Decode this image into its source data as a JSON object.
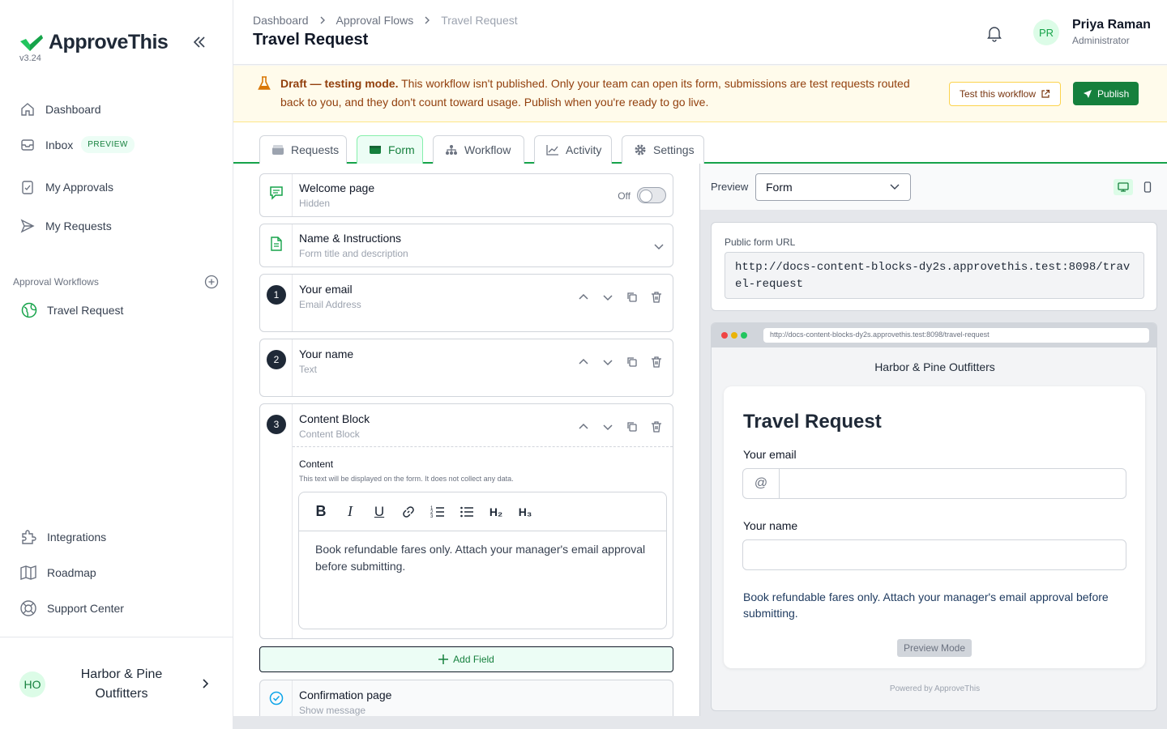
{
  "app": {
    "name": "ApproveThis",
    "version": "v3.24"
  },
  "sidebar": {
    "nav": [
      {
        "label": "Dashboard",
        "icon": "home-icon"
      },
      {
        "label": "Inbox",
        "icon": "inbox-icon",
        "badge": "PREVIEW"
      },
      {
        "label": "My Approvals",
        "icon": "clipboard-check-icon"
      },
      {
        "label": "My Requests",
        "icon": "send-icon"
      }
    ],
    "section_label": "Approval Workflows",
    "workflows": [
      {
        "label": "Travel Request",
        "icon": "globe-icon"
      }
    ],
    "footer_nav": [
      {
        "label": "Integrations",
        "icon": "puzzle-icon"
      },
      {
        "label": "Roadmap",
        "icon": "map-icon"
      },
      {
        "label": "Support Center",
        "icon": "lifebuoy-icon"
      }
    ],
    "org": {
      "initials": "HO",
      "name": "Harbor & Pine Outfitters"
    }
  },
  "header": {
    "breadcrumbs": [
      "Dashboard",
      "Approval Flows",
      "Travel Request"
    ],
    "title": "Travel Request",
    "user": {
      "initials": "PR",
      "name": "Priya Raman",
      "role": "Administrator"
    }
  },
  "banner": {
    "strong": "Draft — testing mode.",
    "text": " This workflow isn't published. Only your team can open its form, submissions are test requests routed back to you, and they don't count toward usage. Publish when you're ready to go live.",
    "test_button": "Test this workflow",
    "publish_button": "Publish",
    "accent": "#92400e"
  },
  "tabs": [
    {
      "label": "Requests",
      "active": false
    },
    {
      "label": "Form",
      "active": true
    },
    {
      "label": "Workflow",
      "active": false
    },
    {
      "label": "Activity",
      "active": false
    },
    {
      "label": "Settings",
      "active": false
    }
  ],
  "form_editor": {
    "welcome": {
      "title": "Welcome page",
      "subtitle": "Hidden",
      "toggle_label": "Off"
    },
    "name_instructions": {
      "title": "Name & Instructions",
      "subtitle": "Form title and description"
    },
    "fields": [
      {
        "number": "1",
        "title": "Your email",
        "type": "Email Address"
      },
      {
        "number": "2",
        "title": "Your name",
        "type": "Text"
      },
      {
        "number": "3",
        "title": "Content Block",
        "type": "Content Block"
      }
    ],
    "content_block": {
      "label": "Content",
      "help": "This text will be displayed on the form. It does not collect any data.",
      "toolbar": [
        "B",
        "I",
        "U",
        "link",
        "ordered-list",
        "bullet-list",
        "H₂",
        "H₃"
      ],
      "text": "Book refundable fares only. Attach your manager's email approval before submitting."
    },
    "add_field": "Add Field",
    "confirmation": {
      "title": "Confirmation page",
      "subtitle": "Show message"
    }
  },
  "preview": {
    "label": "Preview",
    "mode": "Form",
    "url_label": "Public form URL",
    "url": "http://docs-content-blocks-dy2s.approvethis.test:8098/travel-request",
    "company": "Harbor & Pine Outfitters",
    "form_title": "Travel Request",
    "email_label": "Your email",
    "email_prefix": "@",
    "name_label": "Your name",
    "content": "Book refundable fares only. Attach your manager's email approval before submitting.",
    "mode_badge": "Preview Mode",
    "powered_by": "Powered by ApproveThis"
  },
  "colors": {
    "brand": "#16a34a",
    "brand_dark": "#15803d",
    "warning_bg": "#fffbeb"
  }
}
